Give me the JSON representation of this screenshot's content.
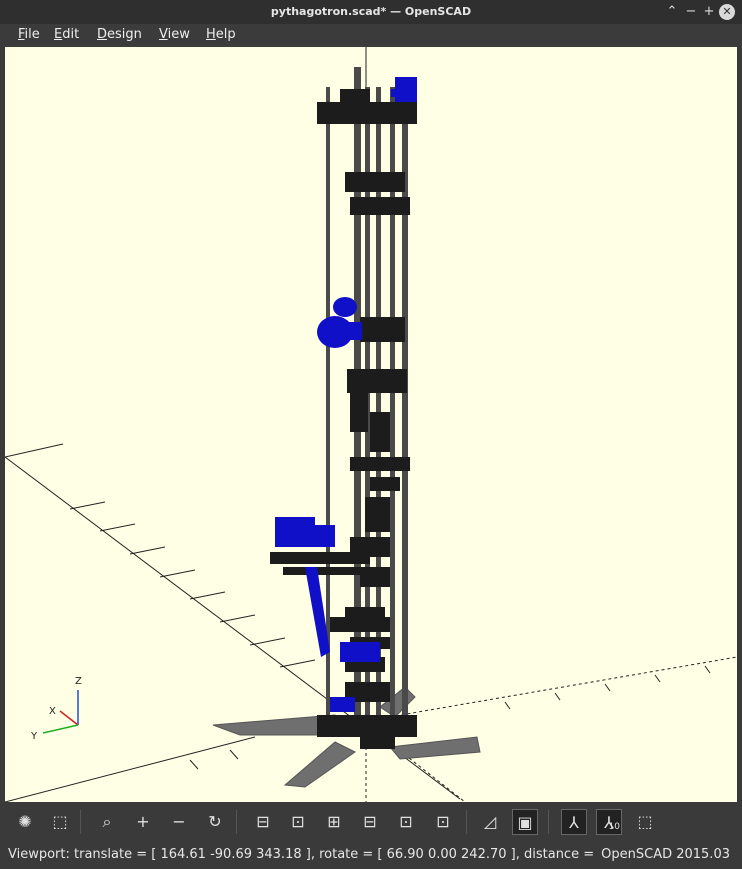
{
  "window": {
    "title": "pythagotron.scad* — OpenSCAD",
    "controls": {
      "minimize_up": "⌃",
      "minimize": "−",
      "maximize": "+",
      "close": "✕"
    }
  },
  "menubar": {
    "items": [
      {
        "label": "File",
        "accel": "F",
        "rest": "ile"
      },
      {
        "label": "Edit",
        "accel": "E",
        "rest": "dit"
      },
      {
        "label": "Design",
        "accel": "D",
        "rest": "esign"
      },
      {
        "label": "View",
        "accel": "V",
        "rest": "iew"
      },
      {
        "label": "Help",
        "accel": "H",
        "rest": "elp"
      }
    ]
  },
  "viewport": {
    "background": "#ffffe5",
    "axis_label_z": "Z",
    "axis_label_x": "X",
    "axis_label_y": "Y",
    "model_colors": {
      "dark": "#1c1c1c",
      "blue": "#1010c8",
      "base": "#6f6f6f",
      "rod": "#4a4a4a"
    }
  },
  "toolbar": {
    "buttons": [
      {
        "name": "preview-icon",
        "glyph": "✺"
      },
      {
        "name": "render-icon",
        "glyph": "⬚"
      },
      {
        "name": "view-all-icon",
        "glyph": "⌕"
      },
      {
        "name": "zoom-in-icon",
        "glyph": "+"
      },
      {
        "name": "zoom-out-icon",
        "glyph": "−"
      },
      {
        "name": "reset-view-icon",
        "glyph": "↻"
      },
      {
        "name": "view-right-icon",
        "glyph": "⊟"
      },
      {
        "name": "view-top-icon",
        "glyph": "⊡"
      },
      {
        "name": "view-bottom-icon",
        "glyph": "⊞"
      },
      {
        "name": "view-left-icon",
        "glyph": "⊟"
      },
      {
        "name": "view-front-icon",
        "glyph": "⊡"
      },
      {
        "name": "view-back-icon",
        "glyph": "⊡"
      },
      {
        "name": "perspective-icon",
        "glyph": "◿"
      },
      {
        "name": "orthogonal-icon",
        "glyph": "▣"
      },
      {
        "name": "show-axes-icon",
        "glyph": "⅄"
      },
      {
        "name": "show-scale-markers-icon",
        "glyph": "⅄",
        "badge": "10"
      },
      {
        "name": "show-edges-icon",
        "glyph": "⬚"
      }
    ]
  },
  "statusbar": {
    "viewport_info": "Viewport: translate = [ 164.61 -90.69 343.18 ], rotate = [ 66.90 0.00 242.70 ], distance =",
    "version": "OpenSCAD 2015.03"
  }
}
